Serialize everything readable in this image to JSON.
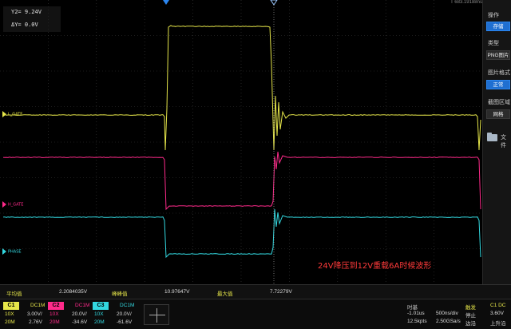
{
  "top_strip": "T 683.19188ns",
  "cursor": {
    "y2": "Y2= 9.24V",
    "dy": "ΔY= 0.0V"
  },
  "channels": [
    {
      "id": "C1",
      "label": "L_GATE",
      "color": "#e6e64a"
    },
    {
      "id": "C2",
      "label": "H_GATE",
      "color": "#ff2a8a"
    },
    {
      "id": "C3",
      "label": "PHASE",
      "color": "#33d8e0"
    }
  ],
  "annotation": "24V降压到12V重载6A时候波形",
  "side_panel": {
    "op_label": "操作",
    "save_btn": "存储",
    "type_label": "类型",
    "type_btn": "PNG图片",
    "format_label": "图片格式",
    "format_btn": "正常",
    "capture_label": "截图区域",
    "capture_btn": "网格",
    "file_label": "文件"
  },
  "measurements": {
    "avg_label": "平均值",
    "avg_value": "2.2084035V",
    "pp_label": "峰峰值",
    "pp_value": "10.97647V",
    "max_label": "最大值",
    "max_value": "7.72279V"
  },
  "channel_bar": [
    {
      "tag": "C1",
      "color": "#e6e64a",
      "coupling": "DC1M",
      "probe": "10X",
      "scale": "3.00V/",
      "bw": "20M",
      "offset": "2.76V"
    },
    {
      "tag": "C2",
      "color": "#ff2a8a",
      "coupling": "DC1M",
      "probe": "10X",
      "scale": "20.0V/",
      "bw": "20M",
      "offset": "-34.6V"
    },
    {
      "tag": "C3",
      "color": "#33d8e0",
      "coupling": "DC1M",
      "probe": "10X",
      "scale": "20.0V/",
      "bw": "20M",
      "offset": "-61.6V"
    }
  ],
  "timebase": {
    "label": "时基",
    "delay": "-1.01us",
    "tdiv": "500ns/div",
    "points": "12.5kpts",
    "rate": "2.50GSa/s"
  },
  "trigger": {
    "label": "触发",
    "channel": "C1 DC",
    "mode": "停止",
    "level": "3.60V",
    "edge_label": "边沿",
    "slope": "上升沿"
  }
}
